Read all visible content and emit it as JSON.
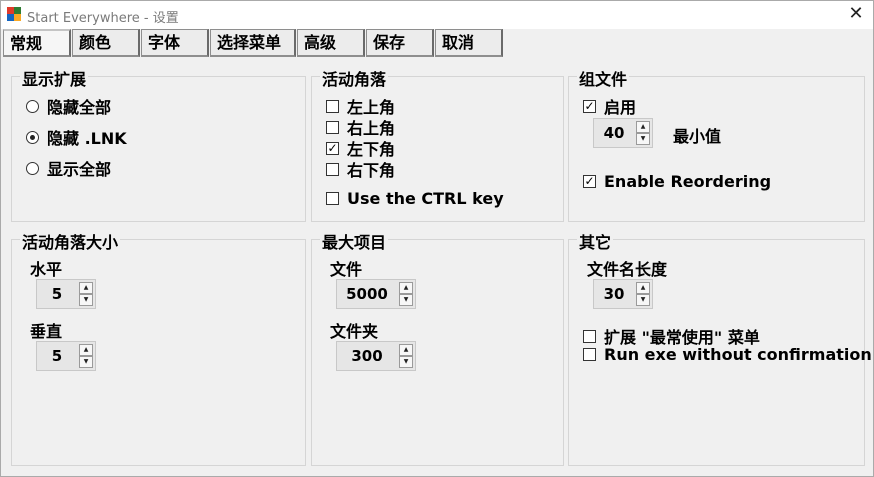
{
  "window": {
    "title": "Start Everywhere - 设置",
    "close_glyph": "✕"
  },
  "tabs": [
    "常规",
    "颜色",
    "字体",
    "选择菜单",
    "高级",
    "保存",
    "取消"
  ],
  "display_ext": {
    "title": "显示扩展",
    "options": [
      {
        "label": "隐藏全部",
        "selected": false
      },
      {
        "label": "隐藏 .LNK",
        "selected": true
      },
      {
        "label": "显示全部",
        "selected": false
      }
    ]
  },
  "hot_corners": {
    "title": "活动角落",
    "items": [
      {
        "label": "左上角",
        "checked": false
      },
      {
        "label": "右上角",
        "checked": false
      },
      {
        "label": "左下角",
        "checked": true
      },
      {
        "label": "右下角",
        "checked": false
      }
    ],
    "ctrl_key": {
      "label": "Use the CTRL key",
      "checked": false
    }
  },
  "group_files": {
    "title": "组文件",
    "enable": {
      "label": "启用",
      "checked": true
    },
    "min_value": "40",
    "min_label": "最小值",
    "reorder": {
      "label": "Enable Reordering",
      "checked": true
    }
  },
  "corner_size": {
    "title": "活动角落大小",
    "horizontal_label": "水平",
    "horizontal_value": "5",
    "vertical_label": "垂直",
    "vertical_value": "5"
  },
  "max_items": {
    "title": "最大项目",
    "files_label": "文件",
    "files_value": "5000",
    "folders_label": "文件夹",
    "folders_value": "300"
  },
  "other": {
    "title": "其它",
    "filename_length_label": "文件名长度",
    "filename_length_value": "30",
    "extend_recent": {
      "label": "扩展 \"最常使用\" 菜单",
      "checked": false
    },
    "run_exe": {
      "label": "Run exe without confirmation",
      "checked": false
    }
  },
  "icons": {
    "check_mark": "✓",
    "spin_up": "▲",
    "spin_down": "▼"
  }
}
